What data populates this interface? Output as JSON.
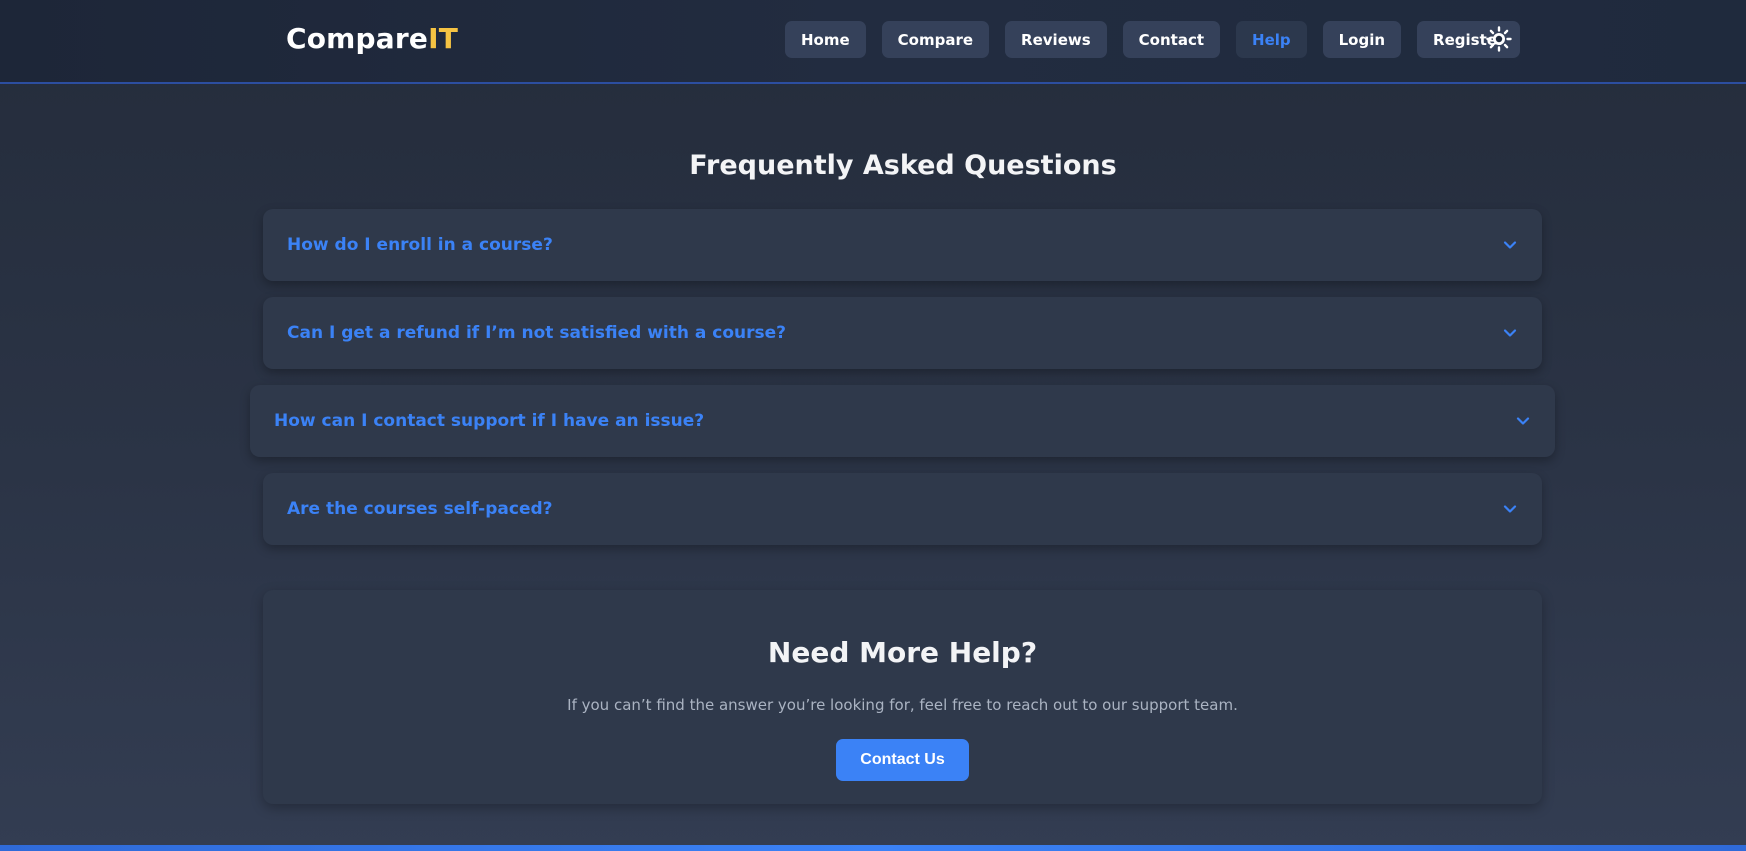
{
  "header": {
    "logo_main": "Compare",
    "logo_accent": "IT",
    "nav": [
      {
        "label": "Home"
      },
      {
        "label": "Compare"
      },
      {
        "label": "Reviews"
      },
      {
        "label": "Contact"
      },
      {
        "label": "Help",
        "active": true
      },
      {
        "label": "Login"
      },
      {
        "label": "Register"
      }
    ],
    "theme_icon": "sun-icon"
  },
  "faq": {
    "title": "Frequently Asked Questions",
    "items": [
      {
        "question": "How do I enroll in a course?"
      },
      {
        "question": "Can I get a refund if I’m not satisfied with a course?"
      },
      {
        "question": "How can I contact support if I have an issue?"
      },
      {
        "question": "Are the courses self-paced?"
      }
    ]
  },
  "help": {
    "title": "Need More Help?",
    "text": "If you can’t find the answer you’re looking for, feel free to reach out to our support team.",
    "button_label": "Contact Us"
  },
  "colors": {
    "accent": "#3b82f6",
    "logo_accent": "#f6c343",
    "background": "#2b3446",
    "card": "#2f394b"
  }
}
